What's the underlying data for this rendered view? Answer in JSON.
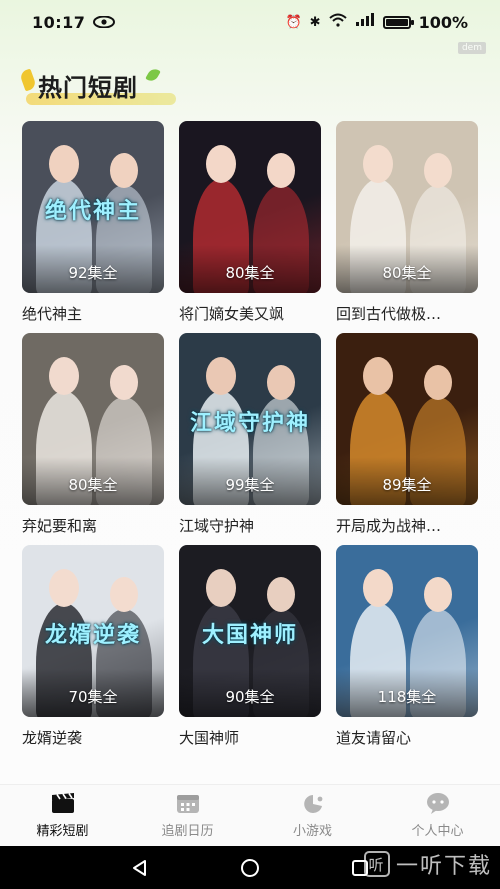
{
  "status_bar": {
    "time": "10:17",
    "battery": "100%",
    "network": "5G",
    "corner_tag": "dem"
  },
  "header": {
    "title": "热门短剧"
  },
  "dramas": [
    {
      "title": "绝代神主",
      "episodes": "92集全",
      "overlay": "绝代神主",
      "bg": "#4a4f5a",
      "accent": "#c9d3df",
      "skin": "#f0d2c0"
    },
    {
      "title": "将门嫡女美又飒",
      "episodes": "80集全",
      "overlay": "",
      "bg": "#1a1620",
      "accent": "#b02a30",
      "skin": "#f3d7c8"
    },
    {
      "title": "回到古代做极…",
      "episodes": "80集全",
      "overlay": "",
      "bg": "#cfc4b3",
      "accent": "#f3f0ea",
      "skin": "#f3dccd"
    },
    {
      "title": "弃妃要和离",
      "episodes": "80集全",
      "overlay": "",
      "bg": "#6f6a63",
      "accent": "#ece7e2",
      "skin": "#f1dace"
    },
    {
      "title": "江域守护神",
      "episodes": "99集全",
      "overlay": "江域守护神",
      "bg": "#2c3b48",
      "accent": "#e8eef2",
      "skin": "#eac8b4"
    },
    {
      "title": "开局成为战神…",
      "episodes": "89集全",
      "overlay": "",
      "bg": "#3b1f0f",
      "accent": "#d58a2c",
      "skin": "#e9c2a6"
    },
    {
      "title": "龙婿逆袭",
      "episodes": "70集全",
      "overlay": "龙婿逆袭",
      "bg": "#dfe3e8",
      "accent": "#2b2d33",
      "skin": "#f3dccf"
    },
    {
      "title": "大国神师",
      "episodes": "90集全",
      "overlay": "大国神师",
      "bg": "#1c1c22",
      "accent": "#3a3a44",
      "skin": "#e8cfc0"
    },
    {
      "title": "道友请留心",
      "episodes": "118集全",
      "overlay": "",
      "bg": "#3a6d9b",
      "accent": "#e7eef5",
      "skin": "#f3d9c9"
    }
  ],
  "nav": [
    {
      "label": "精彩短剧",
      "active": true
    },
    {
      "label": "追剧日历",
      "active": false
    },
    {
      "label": "小游戏",
      "active": false
    },
    {
      "label": "个人中心",
      "active": false
    }
  ],
  "watermark": {
    "text": "一听下载",
    "logo": "听"
  }
}
